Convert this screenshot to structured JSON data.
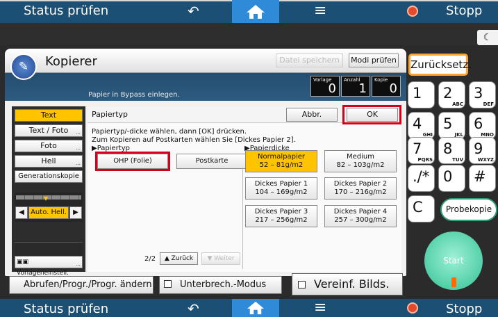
{
  "topbar": {
    "status": "Status prüfen",
    "stop": "Stopp"
  },
  "bottombar": {
    "status": "Status prüfen",
    "stop": "Stopp"
  },
  "app": {
    "title": "Kopierer",
    "save_file": "Datei speichern",
    "check_modes": "Modi prüfen",
    "message": "Papier in Bypass einlegen."
  },
  "counters": [
    {
      "label": "Vorlage",
      "value": "0"
    },
    {
      "label": "Anzahl",
      "value": "1"
    },
    {
      "label": "Kopie",
      "value": "0"
    }
  ],
  "left_modes": [
    "Text",
    "Text / Foto",
    "Foto",
    "Hell",
    "Generationskopie"
  ],
  "density": {
    "label": "Auto. Hell."
  },
  "original_settings": "Vorlageneinstell.",
  "papertype": {
    "title": "Papiertyp",
    "cancel": "Abbr.",
    "ok": "OK",
    "instruction_line1": "Papiertyp/-dicke wählen, dann [OK] drücken.",
    "instruction_line2": "Zum Kopieren auf Postkarten wählen Sie [Dickes Papier 2].",
    "type_header": "▶Papiertyp",
    "thickness_header": "▶Papierdicke",
    "types": [
      "OHP (Folie)",
      "Postkarte"
    ],
    "thickness": [
      {
        "name": "Normalpapier",
        "range": "52 – 81g/m2",
        "selected": true
      },
      {
        "name": "Medium",
        "range": "82 – 103g/m2",
        "selected": false
      },
      {
        "name": "Dickes Papier 1",
        "range": "104 – 169g/m2",
        "selected": false
      },
      {
        "name": "Dickes Papier 2",
        "range": "170 – 216g/m2",
        "selected": false
      },
      {
        "name": "Dickes Papier 3",
        "range": "217 – 256g/m2",
        "selected": false
      },
      {
        "name": "Dickes Papier 4",
        "range": "257 – 300g/m2",
        "selected": false
      }
    ],
    "page": "2/2",
    "back": "Zurück",
    "next": "Weiter"
  },
  "bottom_buttons": {
    "recall": "Abrufen/Progr./Progr. ändern",
    "interrupt": "Unterbrech.-Modus",
    "simplified": "Vereinf. Bilds."
  },
  "keypad": {
    "reset": "Zurücksetz.",
    "keys": [
      {
        "main": "1",
        "sub": ""
      },
      {
        "main": "2",
        "sub": "ABC"
      },
      {
        "main": "3",
        "sub": "DEF"
      },
      {
        "main": "4",
        "sub": "GHI"
      },
      {
        "main": "5",
        "sub": "JKL"
      },
      {
        "main": "6",
        "sub": "MNO"
      },
      {
        "main": "7",
        "sub": "PQRS"
      },
      {
        "main": "8",
        "sub": "TUV"
      },
      {
        "main": "9",
        "sub": "WXYZ"
      },
      {
        "main": "./*",
        "sub": ""
      },
      {
        "main": "0",
        "sub": ""
      },
      {
        "main": "#",
        "sub": ""
      }
    ],
    "clear": "C",
    "sample": "Probekopie",
    "start": "Start"
  },
  "colors": {
    "accent": "#ffc300",
    "header": "#1c4f74",
    "highlight": "#d4001a",
    "start": "#52cfa8"
  }
}
